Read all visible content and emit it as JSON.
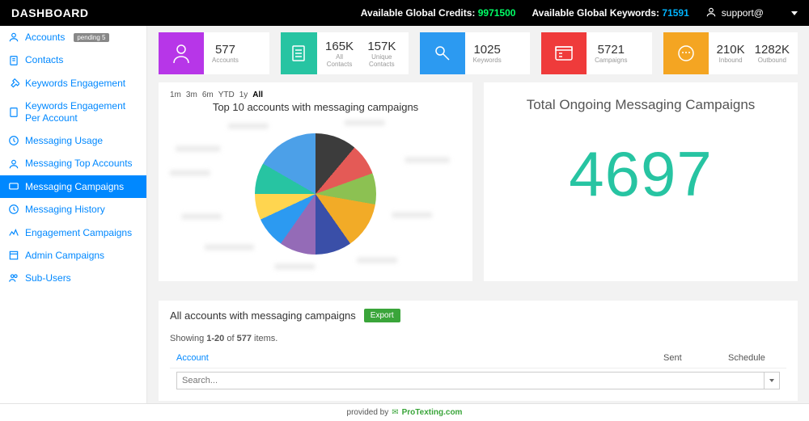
{
  "topbar": {
    "title": "DASHBOARD",
    "credits_label": "Available Global Credits:",
    "credits_value": "9971500",
    "keywords_label": "Available Global Keywords:",
    "keywords_value": "71591",
    "user": "support@"
  },
  "sidebar": {
    "items": [
      {
        "label": "Accounts",
        "badge": "pending 5"
      },
      {
        "label": "Contacts"
      },
      {
        "label": "Keywords Engagement"
      },
      {
        "label": "Keywords Engagement Per Account"
      },
      {
        "label": "Messaging Usage"
      },
      {
        "label": "Messaging Top Accounts"
      },
      {
        "label": "Messaging Campaigns"
      },
      {
        "label": "Messaging History"
      },
      {
        "label": "Engagement Campaigns"
      },
      {
        "label": "Admin Campaigns"
      },
      {
        "label": "Sub-Users"
      }
    ],
    "active_index": 6
  },
  "stats": [
    {
      "color": "purple",
      "values": [
        {
          "num": "577",
          "lbl": "Accounts"
        }
      ]
    },
    {
      "color": "teal",
      "values": [
        {
          "num": "165K",
          "lbl": "All Contacts"
        },
        {
          "num": "157K",
          "lbl": "Unique Contacts"
        }
      ]
    },
    {
      "color": "blue",
      "values": [
        {
          "num": "1025",
          "lbl": "Keywords"
        }
      ]
    },
    {
      "color": "red",
      "values": [
        {
          "num": "5721",
          "lbl": "Campaigns"
        }
      ]
    },
    {
      "color": "orange",
      "values": [
        {
          "num": "210K",
          "lbl": "Inbound"
        },
        {
          "num": "1282K",
          "lbl": "Outbound"
        }
      ]
    }
  ],
  "range": {
    "options": [
      "1m",
      "3m",
      "6m",
      "YTD",
      "1y",
      "All"
    ],
    "selected": "All"
  },
  "chart_data": {
    "type": "pie",
    "title": "Top 10 accounts with messaging campaigns",
    "series": [
      {
        "name": "Account 1",
        "value": 40
      },
      {
        "name": "Account 2",
        "value": 30
      },
      {
        "name": "Account 3",
        "value": 30
      },
      {
        "name": "Account 4",
        "value": 45
      },
      {
        "name": "Account 5",
        "value": 35
      },
      {
        "name": "Account 6",
        "value": 35
      },
      {
        "name": "Account 7",
        "value": 30
      },
      {
        "name": "Account 8",
        "value": 25
      },
      {
        "name": "Account 9",
        "value": 30
      },
      {
        "name": "Account 10",
        "value": 60
      }
    ]
  },
  "ongoing": {
    "title": "Total Ongoing Messaging Campaigns",
    "value": "4697"
  },
  "table": {
    "title": "All accounts with messaging campaigns",
    "export_label": "Export",
    "showing_prefix": "Showing ",
    "showing_range": "1-20",
    "showing_mid": " of ",
    "showing_total": "577",
    "showing_suffix": " items.",
    "columns": [
      "Account",
      "Sent",
      "Schedule"
    ],
    "search_placeholder": "Search..."
  },
  "footer": {
    "provided": "provided by",
    "brand": "ProTexting.com"
  }
}
